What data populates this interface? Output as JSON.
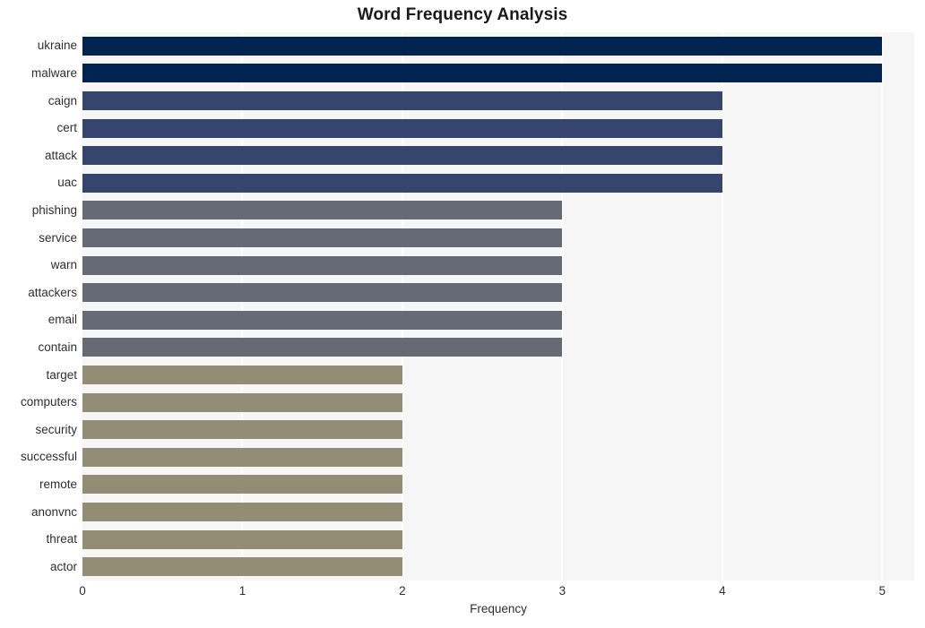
{
  "chart_data": {
    "type": "bar",
    "orientation": "horizontal",
    "title": "Word Frequency Analysis",
    "xlabel": "Frequency",
    "ylabel": "",
    "xlim": [
      0,
      5.2
    ],
    "xticks": [
      0,
      1,
      2,
      3,
      4,
      5
    ],
    "xtick_labels": [
      "0",
      "1",
      "2",
      "3",
      "4",
      "5"
    ],
    "grid": true,
    "grid_axis": "x",
    "legend": false,
    "categories": [
      "ukraine",
      "malware",
      "caign",
      "cert",
      "attack",
      "uac",
      "phishing",
      "service",
      "warn",
      "attackers",
      "email",
      "contain",
      "target",
      "computers",
      "security",
      "successful",
      "remote",
      "anonvnc",
      "threat",
      "actor"
    ],
    "values": [
      5,
      5,
      4,
      4,
      4,
      4,
      3,
      3,
      3,
      3,
      3,
      3,
      2,
      2,
      2,
      2,
      2,
      2,
      2,
      2
    ],
    "bar_colors": [
      "#00234f",
      "#00234f",
      "#35456e",
      "#35456e",
      "#35456e",
      "#35456e",
      "#666a75",
      "#666a75",
      "#666a75",
      "#666a75",
      "#666a75",
      "#666a75",
      "#938d76",
      "#938d76",
      "#938d76",
      "#938d76",
      "#938d76",
      "#938d76",
      "#938d76",
      "#938d76"
    ],
    "plot_background": "#f6f6f7",
    "figure_background": "#ffffff",
    "gridline_color": "#ffffff"
  }
}
